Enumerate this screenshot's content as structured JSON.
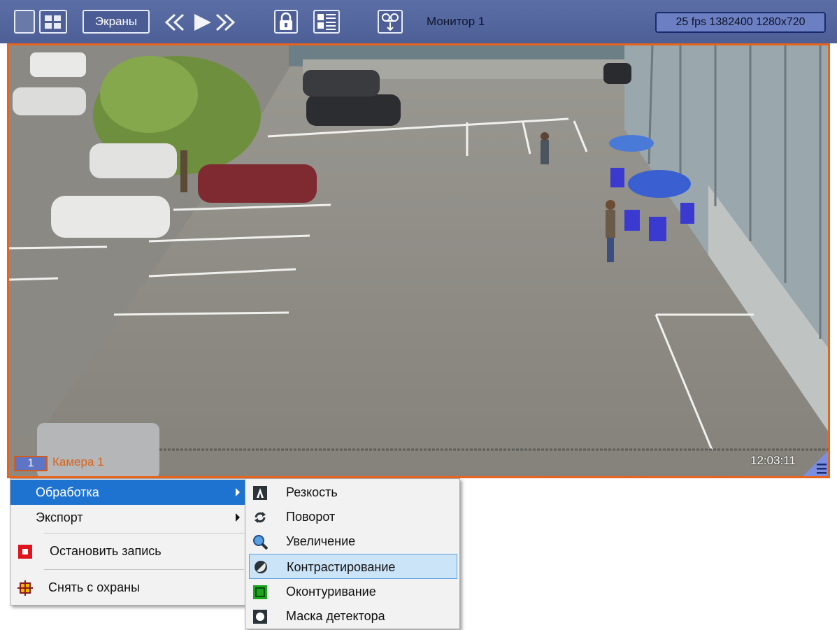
{
  "toolbar": {
    "screens_label": "Экраны",
    "monitor_label": "Монитор 1",
    "stream_info": "25 fps 1382400 1280x720"
  },
  "camera": {
    "number": "1",
    "name": "Камера 1",
    "time": "12:03:11"
  },
  "context_menu": {
    "processing": "Обработка",
    "export": "Экспорт",
    "stop_record": "Остановить запись",
    "disarm": "Снять с охраны"
  },
  "submenu": {
    "sharpness": "Резкость",
    "rotation": "Поворот",
    "zoom": "Увеличение",
    "contrast": "Контрастирование",
    "contouring": "Оконтуривание",
    "detector_mask": "Маска детектора"
  },
  "colors": {
    "toolbar": "#4d5f96",
    "accent_orange": "#e8641e",
    "menu_highlight": "#1e73d1",
    "submenu_highlight": "#cce4f7"
  }
}
